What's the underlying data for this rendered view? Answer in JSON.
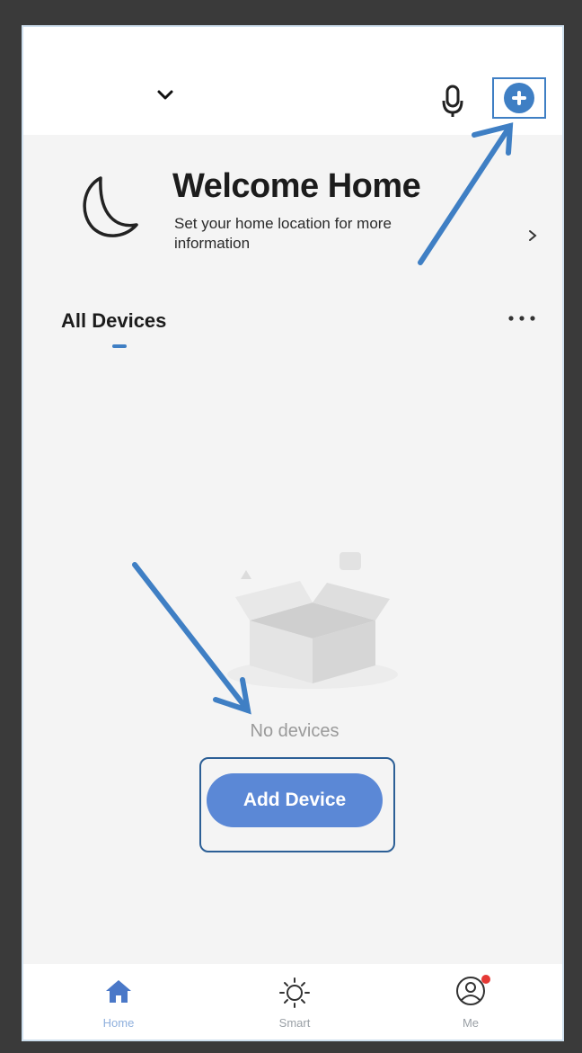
{
  "header": {
    "dropdown_icon": "chevron-down-icon",
    "mic_icon": "microphone-icon",
    "add_icon": "plus-circle-icon"
  },
  "welcome": {
    "title": "Welcome Home",
    "subtitle": "Set your home location for more information",
    "icon": "moon-icon"
  },
  "devices": {
    "section_title": "All Devices",
    "more_icon": "more-dots-icon",
    "empty_text": "No devices",
    "add_button": "Add Device",
    "illustration": "empty-box-illustration"
  },
  "tabs": [
    {
      "label": "Home",
      "icon": "home-icon",
      "active": true
    },
    {
      "label": "Smart",
      "icon": "sun-icon",
      "active": false
    },
    {
      "label": "Me",
      "icon": "profile-icon",
      "active": false,
      "badge": true
    }
  ],
  "colors": {
    "accent": "#3f7fc4",
    "button": "#5b88d6",
    "background": "#f4f4f4",
    "badge": "#e53935",
    "frame": "#3a3a3a"
  }
}
